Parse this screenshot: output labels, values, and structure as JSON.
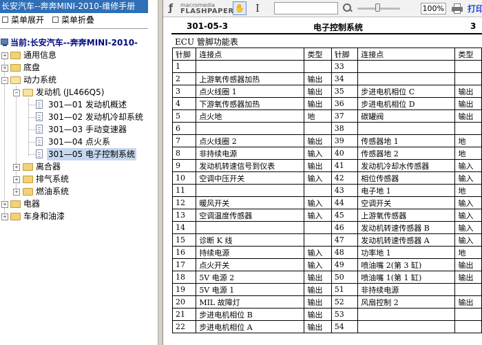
{
  "app_title": "长安汽车--奔奔MINI-2010-维修手册",
  "menu": {
    "expand_label": "菜单展开",
    "collapse_label": "菜单折叠"
  },
  "tree": {
    "current_label": "当前:长安汽车--奔奔MINI-2010-",
    "items": [
      {
        "label": "通用信息"
      },
      {
        "label": "底盘"
      },
      {
        "label": "动力系统"
      },
      {
        "label": "发动机 (JL466Q5)"
      },
      {
        "label": "301—01 发动机概述"
      },
      {
        "label": "301—02 发动机冷却系统"
      },
      {
        "label": "301—03 手动变速器"
      },
      {
        "label": "301—04 点火系"
      },
      {
        "label": "301—05 电子控制系统"
      },
      {
        "label": "离合器"
      },
      {
        "label": "排气系统"
      },
      {
        "label": "燃油系统"
      },
      {
        "label": "电器"
      },
      {
        "label": "车身和油漆"
      }
    ]
  },
  "toolbar": {
    "brand_top": "macromedia",
    "brand_main": "FLASHPAPER",
    "search_value": "",
    "zoom": "100%",
    "print_label": "打印"
  },
  "document": {
    "code": "301-05-3",
    "section": "电子控制系统",
    "right_mark": "3",
    "caption": "ECU 管脚功能表",
    "headers": [
      "针脚",
      "连接点",
      "类型",
      "针脚",
      "连接点",
      "类型"
    ],
    "rows": [
      [
        "1",
        "",
        "",
        "33",
        "",
        ""
      ],
      [
        "2",
        "上游氧传感器加热",
        "输出",
        "34",
        "",
        ""
      ],
      [
        "3",
        "点火线圈 1",
        "输出",
        "35",
        "步进电机相位 C",
        "输出"
      ],
      [
        "4",
        "下游氧传感器加热",
        "输出",
        "36",
        "步进电机相位 D",
        "输出"
      ],
      [
        "5",
        "点火地",
        "地",
        "37",
        "碳罐阀",
        "输出"
      ],
      [
        "6",
        "",
        "",
        "38",
        "",
        ""
      ],
      [
        "7",
        "点火线圈 2",
        "输出",
        "39",
        "传感器地 1",
        "地"
      ],
      [
        "8",
        "非持续电源",
        "输入",
        "40",
        "传感器地 2",
        "地"
      ],
      [
        "9",
        "发动机转速信号到仪表",
        "输出",
        "41",
        "发动机冷却水传感器",
        "输入"
      ],
      [
        "10",
        "空调中压开关",
        "输入",
        "42",
        "相位传感器",
        "输入"
      ],
      [
        "11",
        "",
        "",
        "43",
        "电子地 1",
        "地"
      ],
      [
        "12",
        "暖风开关",
        "输入",
        "44",
        "空调开关",
        "输入"
      ],
      [
        "13",
        "空调温度传感器",
        "输入",
        "45",
        "上游氧传感器",
        "输入"
      ],
      [
        "14",
        "",
        "",
        "46",
        "发动机转速传感器 B",
        "输入"
      ],
      [
        "15",
        "诊断 K 线",
        "",
        "47",
        "发动机转速传感器 A",
        "输入"
      ],
      [
        "16",
        "持续电源",
        "输入",
        "48",
        "功率地 1",
        "地"
      ],
      [
        "17",
        "点火开关",
        "输入",
        "49",
        "喷油嘴 2(第 3 缸)",
        "输出"
      ],
      [
        "18",
        "5V 电源 2",
        "输出",
        "50",
        "喷油嘴 1(第 1 缸)",
        "输出"
      ],
      [
        "19",
        "5V 电源 1",
        "输出",
        "51",
        "非持续电源",
        ""
      ],
      [
        "20",
        "MIL 故障灯",
        "输出",
        "52",
        "风扇控制 2",
        "输出"
      ],
      [
        "21",
        "步进电机相位 B",
        "输出",
        "53",
        "",
        ""
      ],
      [
        "22",
        "步进电机相位 A",
        "输出",
        "54",
        "",
        ""
      ]
    ]
  }
}
